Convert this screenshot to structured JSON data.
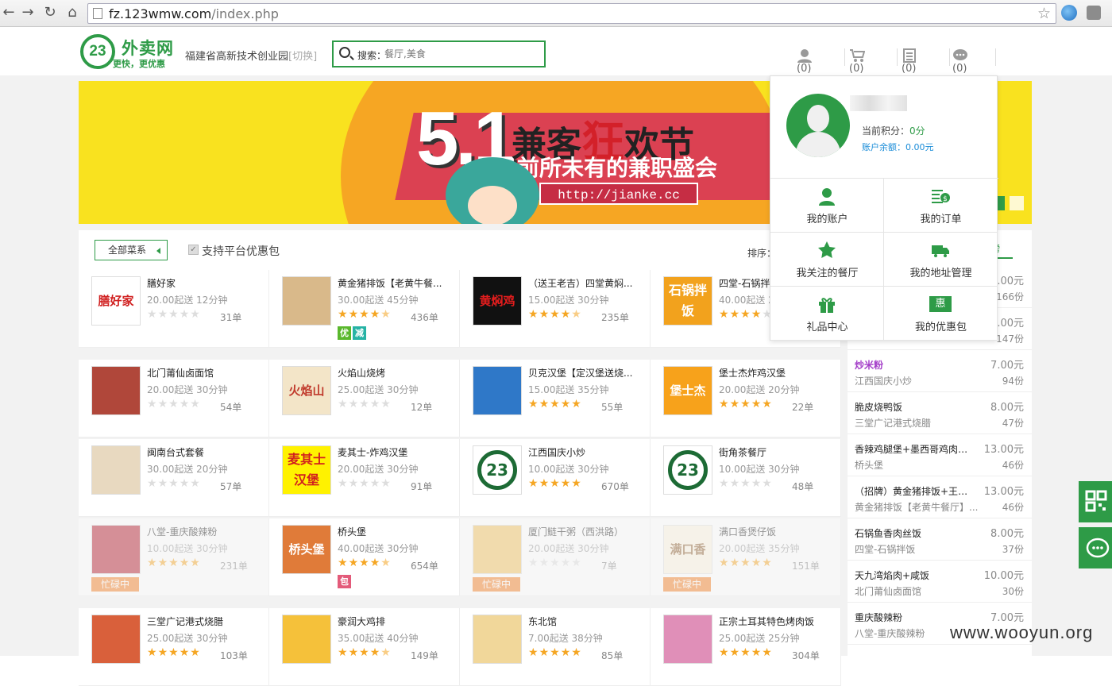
{
  "browser": {
    "url_host": "fz.123wmw.com",
    "url_path": "/index.php"
  },
  "site": {
    "logo_number": "23",
    "logo_name": "外卖网",
    "logo_slogan": "更快，更优惠",
    "location": "福建省高新技术创业园",
    "switch_label": "[切换]",
    "search_label": "搜索：",
    "search_placeholder": "餐厅,美食",
    "counters": {
      "user": "(0)",
      "cart": "(0)",
      "orders": "(0)",
      "messages": "(0)"
    }
  },
  "banner": {
    "number": "5.1",
    "title_a": "兼客",
    "title_b": "狂",
    "title_c": "欢节",
    "subtitle": "前所未有的兼职盛会",
    "url": "http://jianke.cc"
  },
  "filters": {
    "cuisine_label": "全部菜系",
    "checkbox_label": "支持平台优惠包",
    "sort_label": "排序："
  },
  "status_labels": {
    "busy": "忙碌中"
  },
  "restaurants": [
    {
      "name": "膳好家",
      "meta": "20.00起送 12分钟",
      "stars": 0,
      "orders": "31单",
      "thumb_text": "膳好家",
      "thumb_color": "#ffffff",
      "thumb_fg": "#d02020",
      "tags": []
    },
    {
      "name": "黄金猪排饭【老黄牛餐...",
      "meta": "30.00起送 45分钟",
      "stars": 4.5,
      "orders": "436单",
      "thumb_text": "",
      "thumb_color": "#d9b98a",
      "thumb_fg": "#fff",
      "tags": [
        "优",
        "减"
      ]
    },
    {
      "name": "（送王老吉）四堂黄焖...",
      "meta": "15.00起送 30分钟",
      "stars": 4.5,
      "orders": "235单",
      "thumb_text": "黄焖鸡",
      "thumb_color": "#111111",
      "thumb_fg": "#e21d1d",
      "tags": []
    },
    {
      "name": "四堂-石锅拌饭",
      "meta": "40.00起送 2",
      "stars": 4,
      "orders": "",
      "thumb_text": "石锅拌饭",
      "thumb_color": "#f2a21d",
      "thumb_fg": "#fff",
      "tags": []
    },
    {
      "name": "北门莆仙卤面馆",
      "meta": "20.00起送 30分钟",
      "stars": 0,
      "orders": "54单",
      "thumb_text": "",
      "thumb_color": "#b0473a",
      "thumb_fg": "#fff",
      "tags": []
    },
    {
      "name": "火焰山烧烤",
      "meta": "25.00起送 30分钟",
      "stars": 0,
      "orders": "12单",
      "thumb_text": "火焰山",
      "thumb_color": "#f3e5c8",
      "thumb_fg": "#c0392b",
      "tags": []
    },
    {
      "name": "贝克汉堡【定汉堡送烧...",
      "meta": "15.00起送 35分钟",
      "stars": 5,
      "orders": "55单",
      "thumb_text": "",
      "thumb_color": "#2f78c8",
      "thumb_fg": "#fff",
      "tags": []
    },
    {
      "name": "堡士杰炸鸡汉堡",
      "meta": "20.00起送 20分钟",
      "stars": 5,
      "orders": "22单",
      "thumb_text": "堡士杰",
      "thumb_color": "#f7a21b",
      "thumb_fg": "#fff",
      "tags": []
    },
    {
      "name": "闽南台式套餐",
      "meta": "30.00起送 20分钟",
      "stars": 0,
      "orders": "57单",
      "thumb_text": "",
      "thumb_color": "#e8d9c0",
      "thumb_fg": "#fff",
      "tags": []
    },
    {
      "name": "麦其士-炸鸡汉堡",
      "meta": "20.00起送 30分钟",
      "stars": 0,
      "orders": "91单",
      "thumb_text": "麦其士汉堡",
      "thumb_color": "#fff200",
      "thumb_fg": "#d11e1e",
      "tags": []
    },
    {
      "name": "江西国庆小炒",
      "meta": "10.00起送 30分钟",
      "stars": 5,
      "orders": "670单",
      "thumb_text": "23",
      "thumb_color": "#ffffff",
      "thumb_fg": "#1d6b35",
      "tags": []
    },
    {
      "name": "街角茶餐厅",
      "meta": "10.00起送 30分钟",
      "stars": 0,
      "orders": "48单",
      "thumb_text": "23",
      "thumb_color": "#ffffff",
      "thumb_fg": "#1d6b35",
      "tags": []
    },
    {
      "name": "八堂-重庆酸辣粉",
      "meta": "10.00起送 30分钟",
      "stars": 5,
      "orders": "231单",
      "thumb_text": "",
      "thumb_color": "#b2182b",
      "thumb_fg": "#fff",
      "tags": [],
      "busy": true
    },
    {
      "name": "桥头堡",
      "meta": "40.00起送 30分钟",
      "stars": 4.5,
      "orders": "654单",
      "thumb_text": "桥头堡",
      "thumb_color": "#e07b39",
      "thumb_fg": "#fff",
      "tags": [
        "包"
      ]
    },
    {
      "name": "厦门鲢干粥（西洪路）",
      "meta": "20.00起送 30分钟",
      "stars": 0,
      "orders": "7单",
      "thumb_text": "",
      "thumb_color": "#f0c05a",
      "thumb_fg": "#fff",
      "tags": [],
      "busy": true
    },
    {
      "name": "满口香煲仔饭",
      "meta": "20.00起送 35分钟",
      "stars": 5,
      "orders": "151单",
      "thumb_text": "满口香",
      "thumb_color": "#fdf2e0",
      "thumb_fg": "#8a5a2b",
      "tags": [],
      "busy": true
    },
    {
      "name": "三堂广记港式烧腊",
      "meta": "25.00起送 30分钟",
      "stars": 5,
      "orders": "103单",
      "thumb_text": "",
      "thumb_color": "#d9603b",
      "thumb_fg": "#fff",
      "tags": []
    },
    {
      "name": "豪润大鸡排",
      "meta": "35.00起送 40分钟",
      "stars": 4.5,
      "orders": "149单",
      "thumb_text": "",
      "thumb_color": "#f5c13a",
      "thumb_fg": "#fff",
      "tags": []
    },
    {
      "name": "东北馆",
      "meta": "7.00起送 38分钟",
      "stars": 5,
      "orders": "85单",
      "thumb_text": "",
      "thumb_color": "#f1d79a",
      "thumb_fg": "#fff",
      "tags": []
    },
    {
      "name": "正宗土耳其特色烤肉饭",
      "meta": "25.00起送 25分钟",
      "stars": 5,
      "orders": "304单",
      "thumb_text": "",
      "thumb_color": "#e08fb8",
      "thumb_fg": "#fff",
      "tags": []
    }
  ],
  "hot_dishes": [
    {
      "dish": "",
      "shop": "",
      "price": "1.00元",
      "sold": "166份"
    },
    {
      "dish": "",
      "shop": "",
      "price": "1.00元",
      "sold": "147份"
    },
    {
      "dish": "炒米粉",
      "shop": "江西国庆小炒",
      "price": "7.00元",
      "sold": "94份",
      "highlight": true
    },
    {
      "dish": "脆皮烧鸭饭",
      "shop": "三堂广记港式烧腊",
      "price": "8.00元",
      "sold": "47份"
    },
    {
      "dish": "香辣鸡腿堡+墨西哥鸡肉卷+...",
      "shop": "桥头堡",
      "price": "13.00元",
      "sold": "46份"
    },
    {
      "dish": "（招牌）黄金猪排饭+王老...",
      "shop": "黄金猪排饭【老黄牛餐厅】...",
      "price": "13.00元",
      "sold": "46份"
    },
    {
      "dish": "石锅鱼香肉丝饭",
      "shop": "四堂-石锅拌饭",
      "price": "8.00元",
      "sold": "37份"
    },
    {
      "dish": "天九湾焰肉+咸饭",
      "shop": "北门莆仙卤面馆",
      "price": "10.00元",
      "sold": "30份"
    },
    {
      "dish": "重庆酸辣粉",
      "shop": "八堂-重庆酸辣粉",
      "price": "7.00元",
      "sold": ""
    }
  ],
  "rank_tab": "榜",
  "user_panel": {
    "points_label": "当前积分：",
    "points_value": "0分",
    "balance": "账户余额：0.00元",
    "menu": [
      "我的账户",
      "我的订单",
      "我关注的餐厅",
      "我的地址管理",
      "礼品中心",
      "我的优惠包"
    ],
    "coupon_icon_text": "惠"
  },
  "watermark": "www.wooyun.org"
}
